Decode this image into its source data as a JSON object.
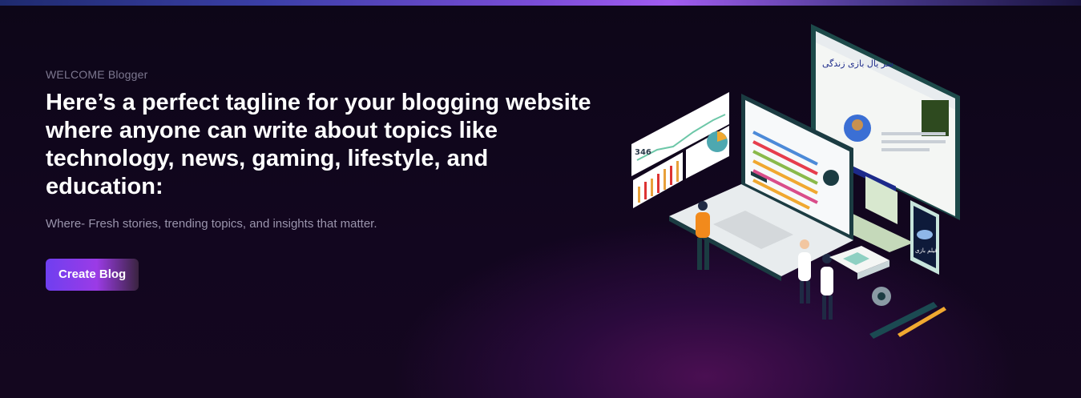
{
  "hero": {
    "welcome": "WELCOME Blogger",
    "headline": "Here’s a perfect tagline for your blogging website where anyone can write about topics like technology, news, gaming, lifestyle, and education:",
    "subtitle": "Where- Fresh stories, trending topics, and insights that matter.",
    "cta_label": "Create Blog"
  },
  "illustration": {
    "dashboard_number": "346",
    "website_heading": "سر یال بازی زندگی",
    "phone_caption": "فیلم بازی"
  },
  "colors": {
    "accent_purple": "#7b3ff0",
    "cta_gradient_end": "#3a2440",
    "background": "#12061f"
  }
}
